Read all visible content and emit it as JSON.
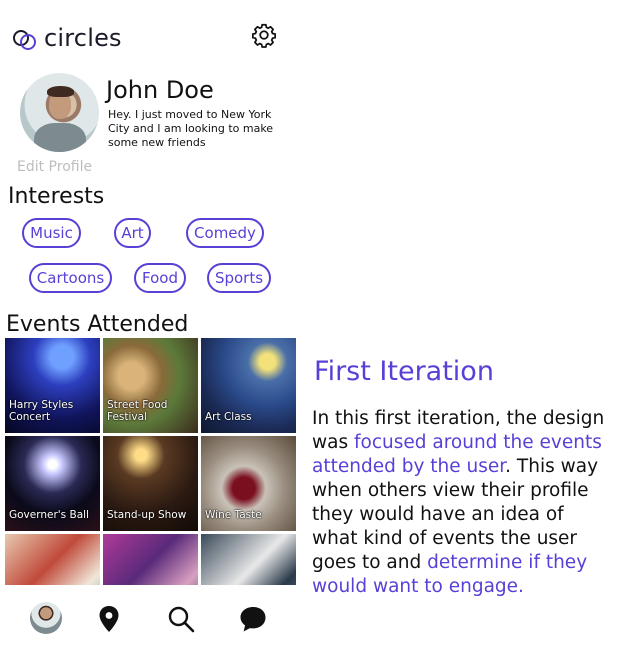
{
  "app": {
    "name": "circles",
    "logo_icon": "overlapping-circles-icon",
    "settings_icon": "gear-icon"
  },
  "profile": {
    "name": "John Doe",
    "bio": "Hey. I just moved to New York City and I am looking to make some new friends",
    "edit_label": "Edit Profile"
  },
  "interests": {
    "title": "Interests",
    "items": [
      "Music",
      "Art",
      "Comedy",
      "Cartoons",
      "Food",
      "Sports"
    ]
  },
  "events": {
    "title": "Events Attended",
    "items": [
      {
        "label": "Harry Styles Concert"
      },
      {
        "label": "Street Food Festival"
      },
      {
        "label": "Art Class"
      },
      {
        "label": "Governer's Ball"
      },
      {
        "label": "Stand-up Show"
      },
      {
        "label": "Wine Taste"
      },
      {
        "label": ""
      },
      {
        "label": ""
      },
      {
        "label": ""
      }
    ]
  },
  "nav": [
    "avatar-icon",
    "map-pin-icon",
    "search-icon",
    "chat-bubble-icon"
  ],
  "iteration": {
    "title": "First Iteration",
    "body_1": "In this first iteration, the design was ",
    "hl_1": "focused around the events attended by the user",
    "body_2": ". This way when others view their profile they would have an idea of what kind of events the user goes to and ",
    "hl_2": "determine if they would want to engage."
  },
  "colors": {
    "accent": "#5a3fd6",
    "muted": "#bdbdbd"
  }
}
